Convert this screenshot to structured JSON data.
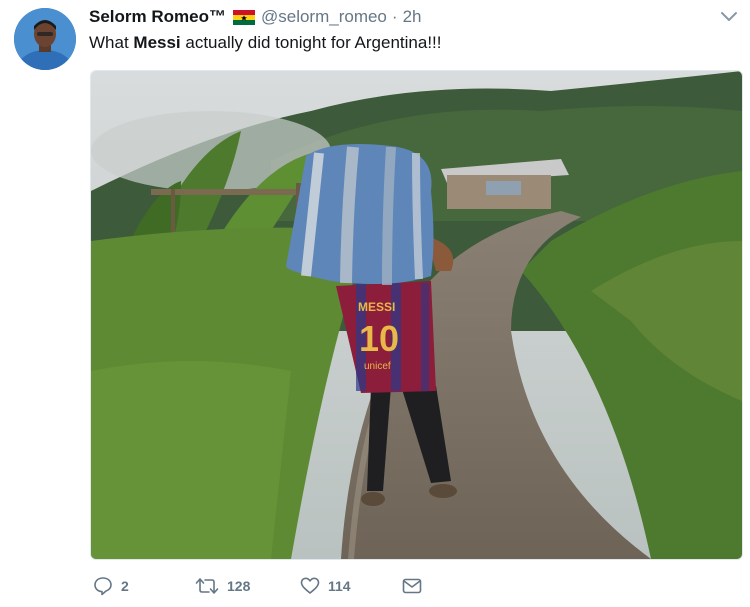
{
  "user": {
    "name": "Selorm Romeo™",
    "handle": "@selorm_romeo",
    "separator": "·",
    "time": "2h"
  },
  "tweet": {
    "text_before": "What ",
    "text_bold": "Messi",
    "text_after": " actually did tonight for Argentina!!!"
  },
  "photo": {
    "jersey_name": "MESSI",
    "jersey_number": "10",
    "jersey_sponsor": "unicef"
  },
  "actions": {
    "replies": "2",
    "retweets": "128",
    "likes": "114"
  },
  "icons": [
    "chevron-down-icon",
    "reply-icon",
    "retweet-icon",
    "like-icon",
    "message-icon"
  ],
  "colors": {
    "text": "#14171a",
    "muted": "#657786",
    "border": "#e1e8ed"
  }
}
